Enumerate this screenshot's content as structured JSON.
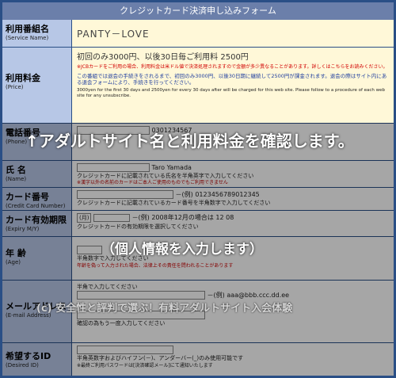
{
  "title": "クレジットカード決済申し込みフォーム",
  "rows": {
    "service": {
      "label": "利用番組名",
      "label_en": "(Service Name)",
      "value": "PANTY－LOVE"
    },
    "price": {
      "label": "利用料金",
      "label_en": "(Price)",
      "value": "初回のみ3000円、以後30日毎ご利用料 2500円",
      "red_note": "※JCBカードをご利用の場合、利用料金は米ドル値で決済処理されますので金額が多少異なることがあります。詳しくはこちらをお読みください。",
      "blue_note": "この番組では退会の手続きをされるまで、初回のみ3000円、以後30日期に継続して2500円が課金されます。退会の際はサイト内にある退会フォームにより、手続きを行ってください。",
      "en_note": "3000yen for the first 30 days and 2500yen for every 30 days after will be charged for this web site. Please follow to a procedure of each web site for any unsubscribe."
    },
    "phone": {
      "label": "電話番号",
      "label_en": "(Phone)",
      "example": "0301234567"
    },
    "name": {
      "label": "氏 名",
      "label_en": "(Name)",
      "example": "Taro Yamada",
      "note": "クレジットカードに記載されている氏名を半角英字で入力してください",
      "note2": "※漢字以外の名前のカードはご本人ご使用のものでもご利用できません"
    },
    "card": {
      "label": "カード番号",
      "label_en": "(Credit Card Number)",
      "example": "－(例) 0123456789012345",
      "note": "クレジットカードに記載されているカード番号を半角数字で入力してください"
    },
    "expiry": {
      "label": "カード有効期限",
      "label_en": "(Expiry M/Y)",
      "month": "(月)",
      "example": "－(例) 2008年12月の場合は 12 08",
      "note": "クレジットカードの有効期限を選択してください"
    },
    "age": {
      "label": "年 齢",
      "label_en": "(Age)",
      "note": "半角数字で入力してください",
      "red": "年齢を偽って入力された場合、法律上その責任を問われることがあります"
    },
    "email": {
      "label": "メールアドレス",
      "label_en": "(E-mail Address)",
      "note": "半角で入力してください",
      "example": "－(例) aaa@bbb.ccc.dd.ee",
      "note2": "確認の為もう一度入力してください"
    },
    "id": {
      "label": "希望するID",
      "label_en": "(Desired ID)",
      "note": "半角英数字およびハイフン(－)、アンダーバー(_)のみ使用可能です",
      "note2": "※最終ご利用パスワードは[決済確認メール]にて通知いたします"
    }
  },
  "overlays": {
    "arrow_caption": "↑アダルトサイト名と利用料金を確認します。",
    "personal_caption": "（個人情報を入力します）",
    "watermark": "(c) 安全性と評判で選ぶ！有料アダルトサイト入会体験"
  },
  "colors": {
    "border": "#2a4f86",
    "label_bg": "#b7c7e6",
    "title_bg": "#6b7faa",
    "highlight": "#fff8d8",
    "caption": "#ffffff",
    "watermark": "#d9d9d9"
  }
}
